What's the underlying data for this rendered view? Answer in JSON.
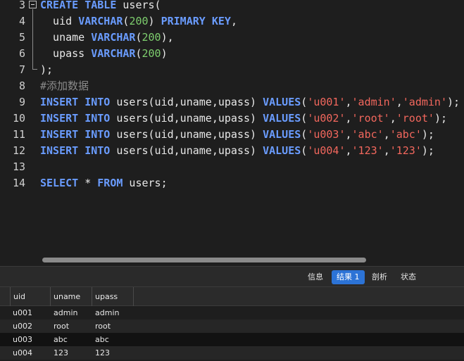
{
  "editor": {
    "line_numbers": [
      "3",
      "4",
      "5",
      "6",
      "7",
      "8",
      "9",
      "10",
      "11",
      "12",
      "13",
      "14"
    ],
    "lines": [
      [
        {
          "t": "CREATE",
          "c": "kw"
        },
        {
          "t": " "
        },
        {
          "t": "TABLE",
          "c": "kw"
        },
        {
          "t": " users("
        }
      ],
      [
        {
          "t": "  uid "
        },
        {
          "t": "VARCHAR",
          "c": "kw"
        },
        {
          "t": "("
        },
        {
          "t": "200",
          "c": "num"
        },
        {
          "t": ") "
        },
        {
          "t": "PRIMARY KEY",
          "c": "kw"
        },
        {
          "t": ","
        }
      ],
      [
        {
          "t": "  uname "
        },
        {
          "t": "VARCHAR",
          "c": "kw"
        },
        {
          "t": "("
        },
        {
          "t": "200",
          "c": "num"
        },
        {
          "t": "),"
        }
      ],
      [
        {
          "t": "  upass "
        },
        {
          "t": "VARCHAR",
          "c": "kw"
        },
        {
          "t": "("
        },
        {
          "t": "200",
          "c": "num"
        },
        {
          "t": ")"
        }
      ],
      [
        {
          "t": ");"
        }
      ],
      [
        {
          "t": "#添加数据",
          "c": "cmt"
        }
      ],
      [
        {
          "t": "INSERT",
          "c": "kw"
        },
        {
          "t": " "
        },
        {
          "t": "INTO",
          "c": "kw"
        },
        {
          "t": " users(uid,uname,upass) "
        },
        {
          "t": "VALUES",
          "c": "kw"
        },
        {
          "t": "("
        },
        {
          "t": "'u001'",
          "c": "str"
        },
        {
          "t": ","
        },
        {
          "t": "'admin'",
          "c": "str"
        },
        {
          "t": ","
        },
        {
          "t": "'admin'",
          "c": "str"
        },
        {
          "t": ");"
        }
      ],
      [
        {
          "t": "INSERT",
          "c": "kw"
        },
        {
          "t": " "
        },
        {
          "t": "INTO",
          "c": "kw"
        },
        {
          "t": " users(uid,uname,upass) "
        },
        {
          "t": "VALUES",
          "c": "kw"
        },
        {
          "t": "("
        },
        {
          "t": "'u002'",
          "c": "str"
        },
        {
          "t": ","
        },
        {
          "t": "'root'",
          "c": "str"
        },
        {
          "t": ","
        },
        {
          "t": "'root'",
          "c": "str"
        },
        {
          "t": ");"
        }
      ],
      [
        {
          "t": "INSERT",
          "c": "kw"
        },
        {
          "t": " "
        },
        {
          "t": "INTO",
          "c": "kw"
        },
        {
          "t": " users(uid,uname,upass) "
        },
        {
          "t": "VALUES",
          "c": "kw"
        },
        {
          "t": "("
        },
        {
          "t": "'u003'",
          "c": "str"
        },
        {
          "t": ","
        },
        {
          "t": "'abc'",
          "c": "str"
        },
        {
          "t": ","
        },
        {
          "t": "'abc'",
          "c": "str"
        },
        {
          "t": ");"
        }
      ],
      [
        {
          "t": "INSERT",
          "c": "kw"
        },
        {
          "t": " "
        },
        {
          "t": "INTO",
          "c": "kw"
        },
        {
          "t": " users(uid,uname,upass) "
        },
        {
          "t": "VALUES",
          "c": "kw"
        },
        {
          "t": "("
        },
        {
          "t": "'u004'",
          "c": "str"
        },
        {
          "t": ","
        },
        {
          "t": "'123'",
          "c": "str"
        },
        {
          "t": ","
        },
        {
          "t": "'123'",
          "c": "str"
        },
        {
          "t": ");"
        }
      ],
      [],
      [
        {
          "t": "SELECT",
          "c": "kw"
        },
        {
          "t": " * "
        },
        {
          "t": "FROM",
          "c": "kw"
        },
        {
          "t": " users;"
        }
      ]
    ]
  },
  "tabs": {
    "info": "信息",
    "result1": "结果 1",
    "profile": "剖析",
    "status": "状态"
  },
  "results": {
    "headers": [
      "uid",
      "uname",
      "upass"
    ],
    "rows": [
      [
        "u001",
        "admin",
        "admin"
      ],
      [
        "u002",
        "root",
        "root"
      ],
      [
        "u003",
        "abc",
        "abc"
      ],
      [
        "u004",
        "123",
        "123"
      ]
    ]
  },
  "colors": {
    "keyword": "#6a9cff",
    "number": "#7ecf6e",
    "string": "#f2675d",
    "comment": "#8a8a8a",
    "active_tab": "#2c73d6"
  }
}
